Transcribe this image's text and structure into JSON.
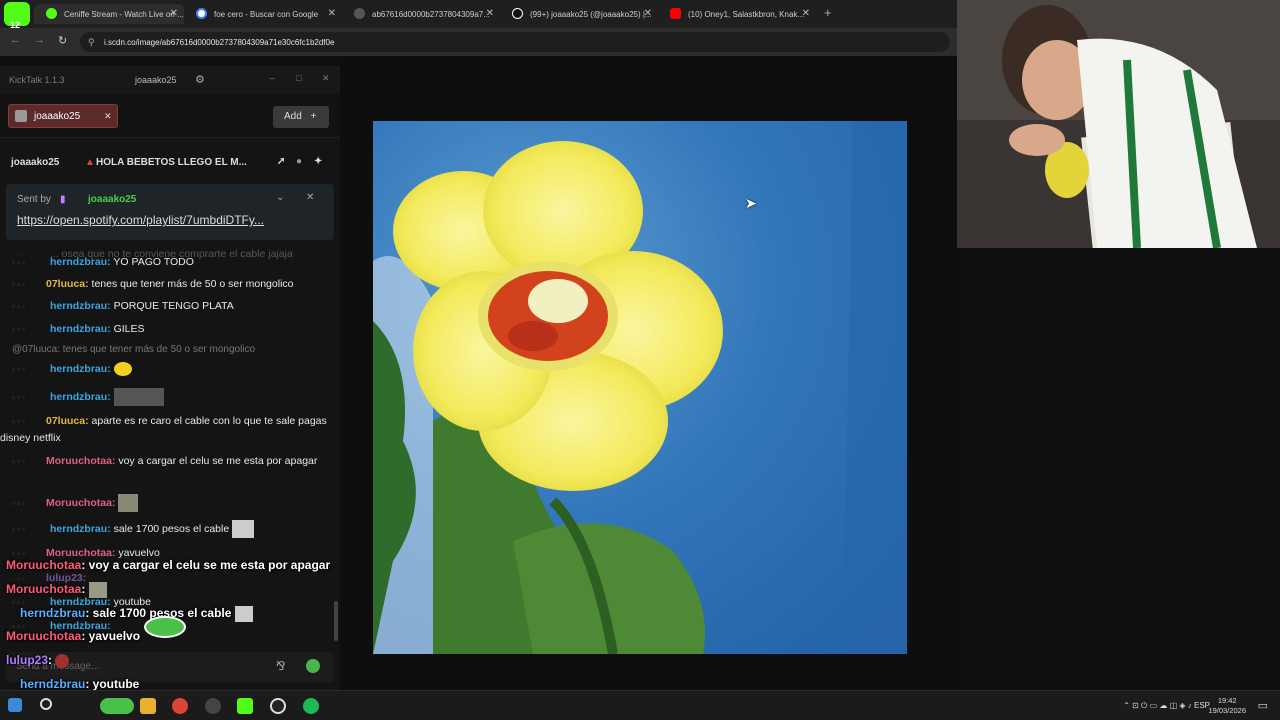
{
  "browser": {
    "tabs": [
      {
        "label": "Ceniffe Stream - Watch Live on ...",
        "icon": "kick-icon",
        "color": "#53fc18"
      },
      {
        "label": "foe cero - Buscar con Google",
        "icon": "google-icon",
        "color": "#4285f4"
      },
      {
        "label": "ab67616d0000b2737804309a7...",
        "icon": "globe-icon",
        "color": "#9aa0a6"
      },
      {
        "label": "(99+) joaaako25 (@joaaako25) |...",
        "icon": "tiktok-icon",
        "color": "#ffffff"
      },
      {
        "label": "(10) Oney1, Salastkbron, Knak...",
        "icon": "youtube-icon",
        "color": "#ff0000"
      }
    ],
    "badge": "12",
    "url": "i.scdn.co/image/ab67616d0000b2737804309a71e30c6fc1b2df0e"
  },
  "kicktalk": {
    "app_title": "KickTalk 1.1.3",
    "username": "joaaako25",
    "channel_tab": "joaaako25",
    "add_label": "Add",
    "pinbar_channel": "joaaako25",
    "pinbar_title": "HOLA BEBETOS LLEGO EL M...",
    "pinned": {
      "sent_by_label": "Sent by",
      "sender": "joaaako25",
      "link": "https://open.spotify.com/playlist/7umbdiDTFy..."
    },
    "faded_line": "... osea que no te conviene comprarte el cable jajaja",
    "messages": [
      {
        "user": "herndzbrau:",
        "text": "YO PAGO TODO",
        "color": "green"
      },
      {
        "user": "07luuca:",
        "text": "tenes que tener más de 50 o ser mongolico",
        "color": "gold"
      },
      {
        "user": "herndzbrau:",
        "text": "PORQUE TENGO PLATA",
        "color": "green"
      },
      {
        "user": "herndzbrau:",
        "text": "GILES",
        "color": "green"
      },
      {
        "user": "herndzbrau:",
        "text": "",
        "color": "green"
      },
      {
        "user": "herndzbrau:",
        "text": "",
        "color": "green"
      },
      {
        "user": "07luuca:",
        "text": "aparte es re caro el cable con lo que te sale pagas disney netflix",
        "color": "gold"
      },
      {
        "user": "Moruuchotaa:",
        "text": "voy a cargar el celu se me esta por apagar",
        "color": "pink"
      },
      {
        "user": "Moruuchotaa:",
        "text": "",
        "color": "pink"
      },
      {
        "user": "herndzbrau:",
        "text": "sale 1700 pesos el cable",
        "color": "green"
      },
      {
        "user": "Moruuchotaa:",
        "text": "yavuelvo",
        "color": "pink"
      },
      {
        "user": "lulup23:",
        "text": "",
        "color": "green"
      },
      {
        "user": "herndzbrau:",
        "text": "youtube",
        "color": "green"
      },
      {
        "user": "herndzbrau:",
        "text": "",
        "color": "green"
      }
    ],
    "reply_line": "@07luuca: tenes que tener más de 50 o ser mongolico",
    "input_placeholder": "Send a message..."
  },
  "overlay": [
    {
      "user": "Moruuchotaa",
      "text": ": voy a cargar el celu se me esta por apagar"
    },
    {
      "user": "Moruuchotaa",
      "text": ":"
    },
    {
      "user": "herndzbrau",
      "text": ": sale 1700 pesos el cable"
    },
    {
      "user": "Moruuchotaa",
      "text": ": yavuelvo"
    },
    {
      "user": "lulup23",
      "text": ":"
    },
    {
      "user": "herndzbrau",
      "text": ": youtube"
    }
  ],
  "taskbar": {
    "lang": "ESP",
    "time": "19:42",
    "date": "19/03/2026"
  }
}
